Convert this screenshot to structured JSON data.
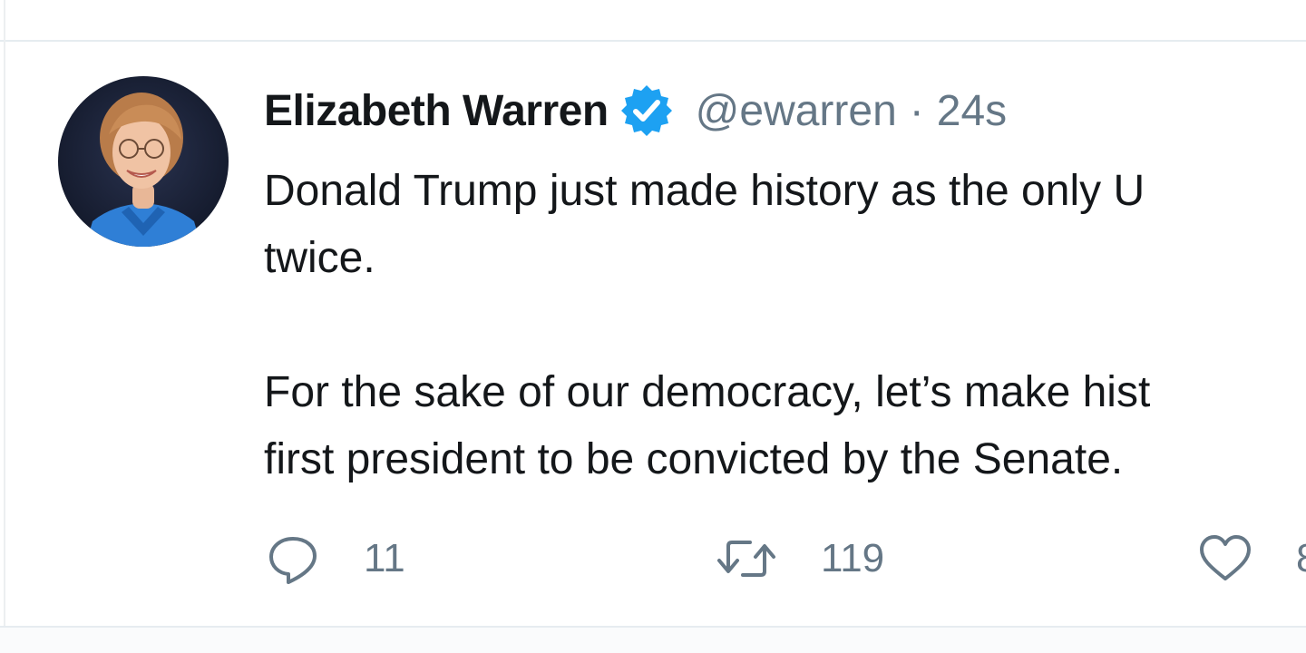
{
  "tweet": {
    "author": {
      "display_name": "Elizabeth Warren",
      "handle": "@ewarren",
      "verified": true
    },
    "separator": "·",
    "timestamp": "24s",
    "text": "Donald Trump just made history as the only U\ntwice.\n\nFor the sake of our democracy, let’s make hist\nfirst president to be convicted by the Senate.",
    "actions": {
      "reply_count": "11",
      "retweet_count": "119",
      "like_count": "8"
    }
  },
  "icons": {
    "verified": "verified-badge-icon",
    "reply": "reply-icon",
    "retweet": "retweet-icon",
    "like": "heart-icon"
  },
  "colors": {
    "text_primary": "#14171a",
    "text_secondary": "#657786",
    "verified_blue": "#1da1f2",
    "divider": "#e6ecf0"
  }
}
